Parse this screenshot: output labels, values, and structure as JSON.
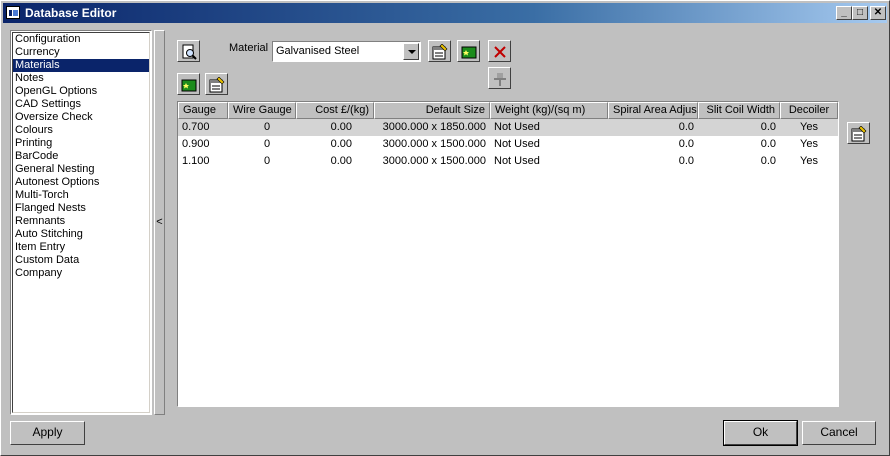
{
  "window": {
    "title": "Database Editor",
    "controls": [
      "_",
      "□",
      "✕"
    ]
  },
  "sidebar": {
    "items": [
      "Configuration",
      "Currency",
      "Materials",
      "Notes",
      "OpenGL Options",
      "CAD Settings",
      "Oversize Check",
      "Colours",
      "Printing",
      "BarCode",
      "General Nesting",
      "Autonest Options",
      "Multi-Torch",
      "Flanged Nests",
      "Remnants",
      "Auto Stitching",
      "Item Entry",
      "Custom Data",
      "Company"
    ],
    "selected": "Materials"
  },
  "splitter": {
    "glyph": "<"
  },
  "material": {
    "label": "Material",
    "value": "Galvanised Steel"
  },
  "table": {
    "headers": [
      "Gauge",
      "Wire Gauge",
      "Cost £/(kg)",
      "Default Size",
      "Weight (kg)/(sq m)",
      "Spiral Area Adjust",
      "Slit Coil Width",
      "Decoiler"
    ],
    "rows": [
      [
        "0.700",
        "0",
        "0.00",
        "3000.000 x 1850.000",
        "Not Used",
        "0.0",
        "0.0",
        "Yes"
      ],
      [
        "0.900",
        "0",
        "0.00",
        "3000.000 x 1500.000",
        "Not Used",
        "0.0",
        "0.0",
        "Yes"
      ],
      [
        "1.100",
        "0",
        "0.00",
        "3000.000 x 1500.000",
        "Not Used",
        "0.0",
        "0.0",
        "Yes"
      ]
    ]
  },
  "buttons": {
    "apply": "Apply",
    "ok": "Ok",
    "cancel": "Cancel"
  },
  "icons": {
    "preview": "magnifier-page-icon",
    "properties": "properties-icon",
    "add": "add-green-icon",
    "delete": "red-x-icon",
    "pin": "pin-icon"
  }
}
